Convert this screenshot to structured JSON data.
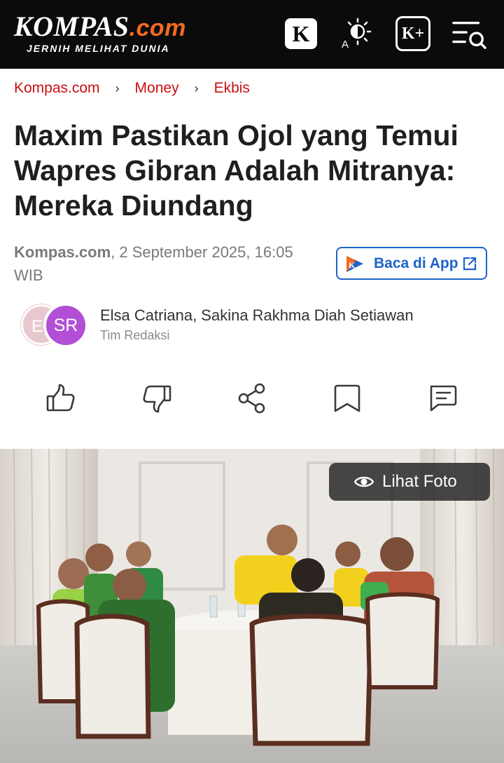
{
  "header": {
    "logo_main": "KOMPAS",
    "logo_dotcom": ".com",
    "logo_tagline": "JERNIH MELIHAT DUNIA",
    "k_icon_label": "K",
    "kplus_icon_label": "K+",
    "icons": [
      "kompas-k-icon",
      "theme-toggle-icon",
      "kompas-plus-icon",
      "menu-search-icon"
    ]
  },
  "breadcrumb": [
    "Kompas.com",
    "Money",
    "Ekbis"
  ],
  "article": {
    "title": "Maxim Pastikan Ojol yang Temui Wapres Gibran Adalah Mitranya: Mereka Diundang",
    "source": "Kompas.com",
    "datetime": ", 2 September 2025, 16:05 WIB",
    "app_button": "Baca di App"
  },
  "authors": {
    "avatar1": "E",
    "avatar2": "SR",
    "names": "Elsa Catriana,  Sakina Rakhma Diah Setiawan",
    "role": "Tim Redaksi"
  },
  "actions": [
    "like-icon",
    "dislike-icon",
    "share-icon",
    "bookmark-icon",
    "comment-icon"
  ],
  "photo": {
    "button": "Lihat Foto"
  },
  "colors": {
    "brand_red": "#c80f0f",
    "brand_orange": "#f26a21",
    "link_blue": "#1e64c8",
    "header_bg": "#0b0b0b"
  }
}
